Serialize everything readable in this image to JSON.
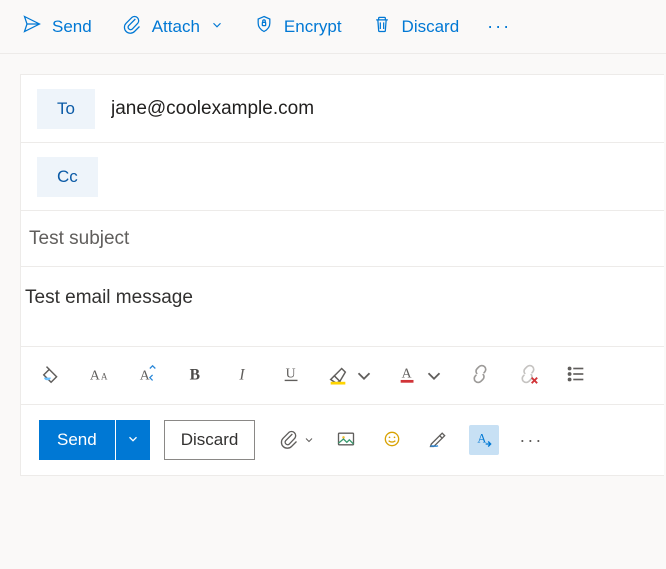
{
  "topToolbar": {
    "send": "Send",
    "attach": "Attach",
    "encrypt": "Encrypt",
    "discard": "Discard"
  },
  "compose": {
    "toLabel": "To",
    "toValue": "jane@coolexample.com",
    "ccLabel": "Cc",
    "ccValue": "",
    "subjectValue": "Test subject",
    "bodyText": "Test email message"
  },
  "bottomBar": {
    "send": "Send",
    "discard": "Discard"
  },
  "colors": {
    "accent": "#0078d4",
    "highlight": "#ffd400",
    "fontColor": "#d13438"
  }
}
